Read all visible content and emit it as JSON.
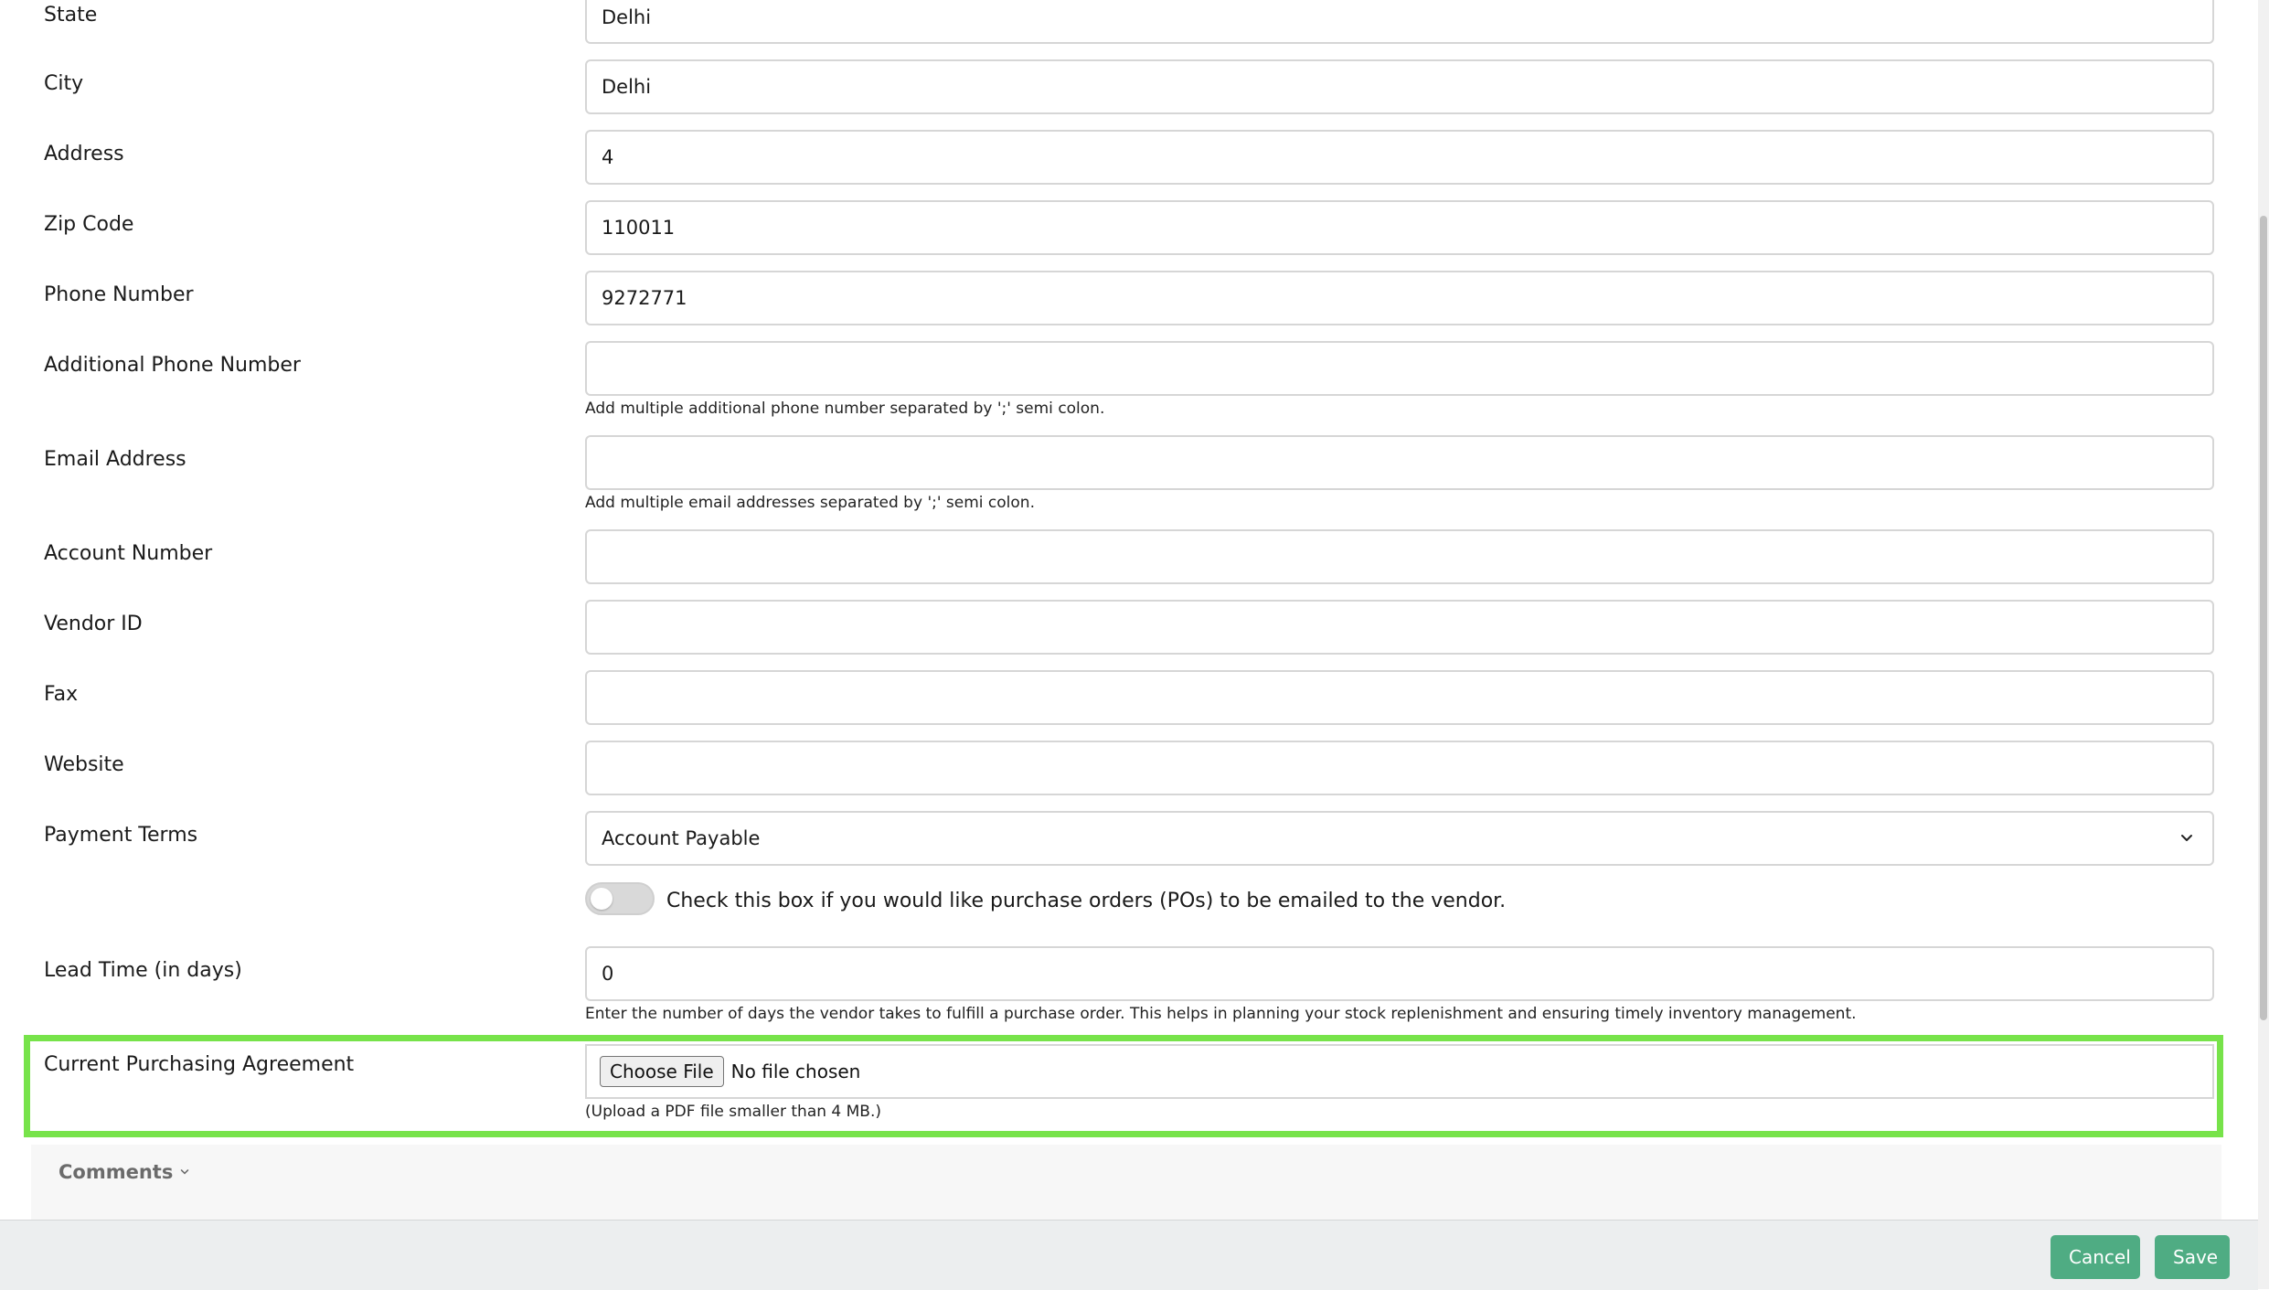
{
  "fields": [
    {
      "key": "state",
      "label": "State",
      "value": "Delhi"
    },
    {
      "key": "city",
      "label": "City",
      "value": "Delhi"
    },
    {
      "key": "address",
      "label": "Address",
      "value": "4"
    },
    {
      "key": "zip",
      "label": "Zip Code",
      "value": "110011"
    },
    {
      "key": "phone",
      "label": "Phone Number",
      "value": "9272771"
    },
    {
      "key": "additional_phone",
      "label": "Additional Phone Number",
      "value": "",
      "help": "Add multiple additional phone number separated by ';' semi colon."
    },
    {
      "key": "email",
      "label": "Email Address",
      "value": "",
      "help": "Add multiple email addresses separated by ';' semi colon."
    },
    {
      "key": "account_number",
      "label": "Account Number",
      "value": ""
    },
    {
      "key": "vendor_id",
      "label": "Vendor ID",
      "value": ""
    },
    {
      "key": "fax",
      "label": "Fax",
      "value": ""
    },
    {
      "key": "website",
      "label": "Website",
      "value": ""
    }
  ],
  "payment_terms": {
    "label": "Payment Terms",
    "selected": "Account Payable",
    "icon": "chevron-down-icon"
  },
  "po_email_toggle": {
    "checked": false,
    "text": "Check this box if you would like purchase orders (POs) to be emailed to the vendor."
  },
  "lead_time": {
    "label": "Lead Time (in days)",
    "value": "0",
    "help": "Enter the number of days the vendor takes to fulfill a purchase order. This helps in planning your stock replenishment and ensuring timely inventory management."
  },
  "purchasing_agreement": {
    "label": "Current Purchasing Agreement",
    "button": "Choose File",
    "status": "No file chosen",
    "help": "(Upload a PDF file smaller than 4 MB.)",
    "highlight_color": "#77e34a"
  },
  "comments": {
    "label": "Comments",
    "icon": "chevron-down-icon"
  },
  "footer": {
    "cancel": "Cancel",
    "save": "Save",
    "button_color": "#4fac83"
  }
}
